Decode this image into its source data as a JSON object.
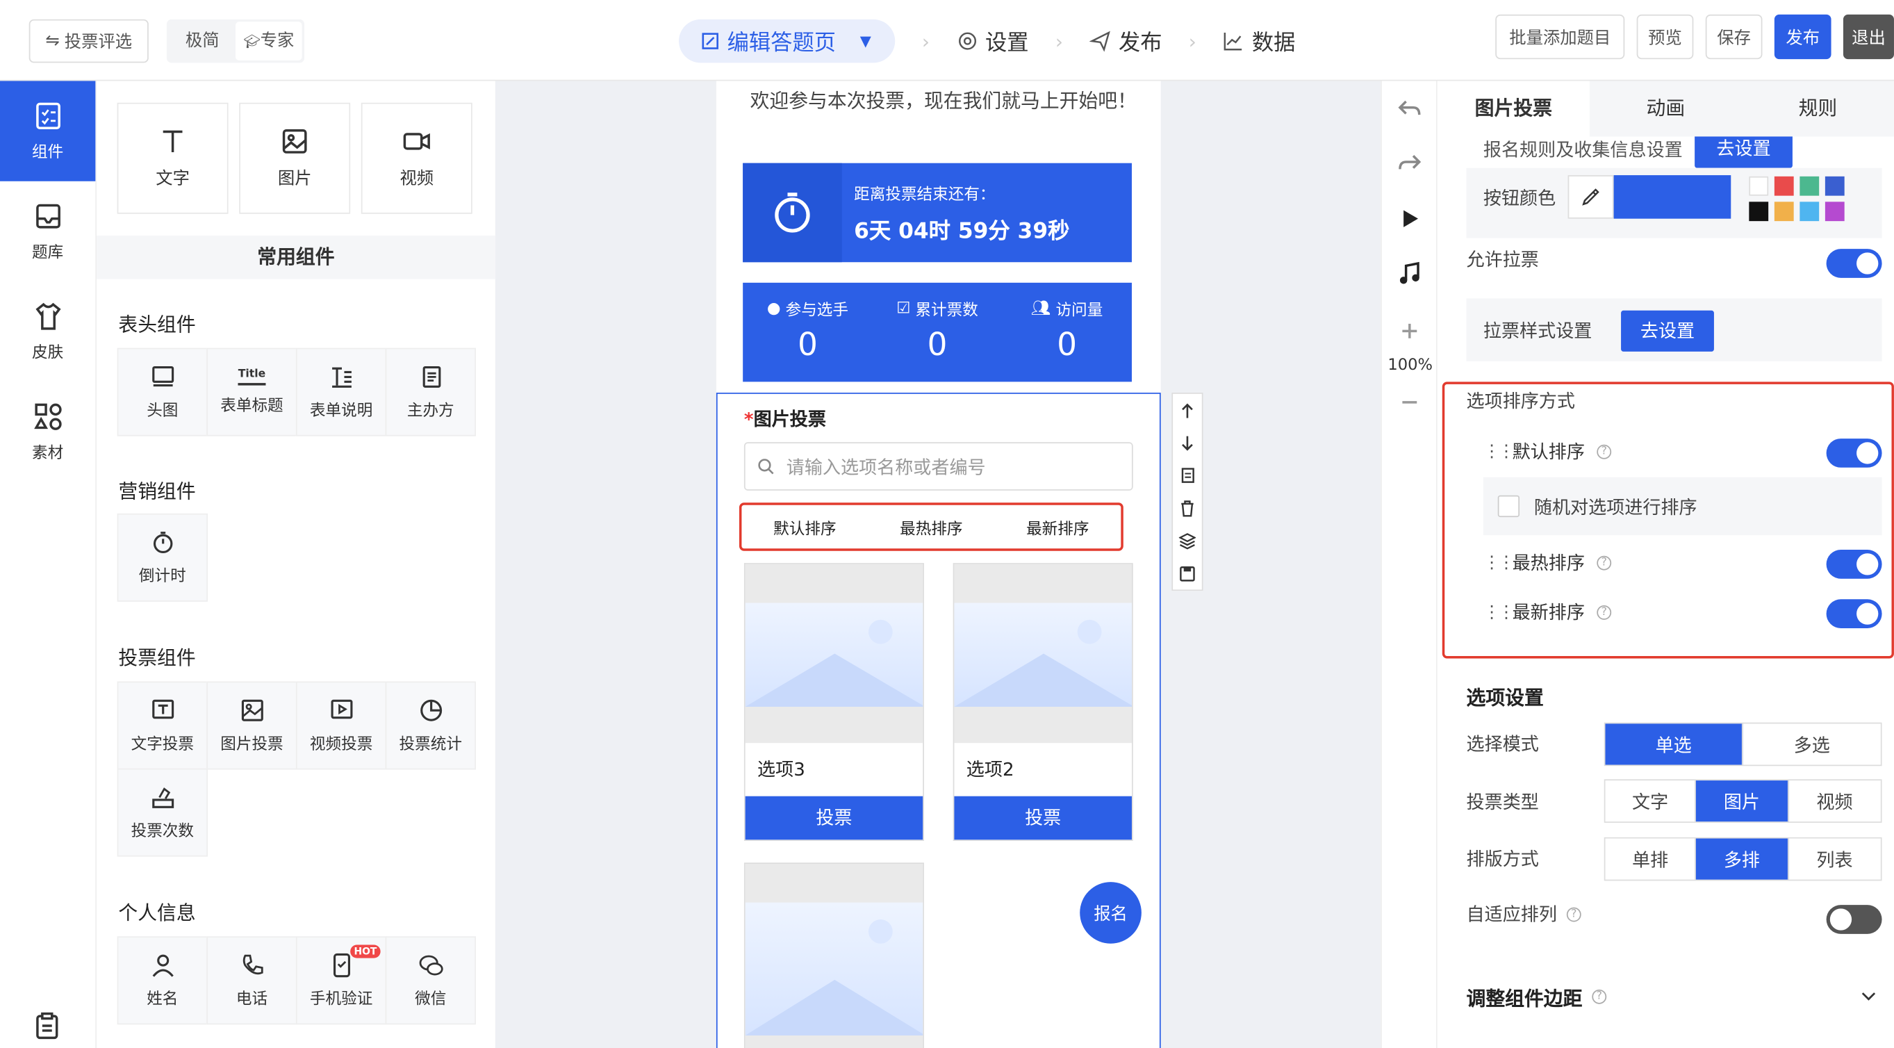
{
  "header": {
    "back_label": "投票评选",
    "mode_simple": "极简",
    "mode_expert": "专家",
    "steps": [
      "编辑答题页",
      "设置",
      "发布",
      "数据"
    ],
    "buttons": {
      "batch_add": "批量添加题目",
      "preview": "预览",
      "save": "保存",
      "publish": "发布",
      "exit": "退出"
    }
  },
  "rail": {
    "items": [
      "组件",
      "题库",
      "皮肤",
      "素材"
    ]
  },
  "components": {
    "basic": [
      "文字",
      "图片",
      "视频"
    ],
    "common_header": "常用组件",
    "sections": [
      {
        "title": "表头组件",
        "items": [
          "头图",
          "表单标题",
          "表单说明",
          "主办方"
        ]
      },
      {
        "title": "营销组件",
        "items": [
          "倒计时"
        ]
      },
      {
        "title": "投票组件",
        "items": [
          "文字投票",
          "图片投票",
          "视频投票",
          "投票统计",
          "投票次数"
        ]
      },
      {
        "title": "个人信息",
        "items": [
          "姓名",
          "电话",
          "手机验证",
          "微信"
        ]
      }
    ],
    "hot_badge": "HOT",
    "title_glyph": "Title"
  },
  "preview": {
    "welcome": "欢迎参与本次投票，现在我们就马上开始吧！",
    "timer_label": "距离投票结束还有：",
    "timer_value": "6天 04时 59分 39秒",
    "stats": [
      {
        "label": "参与选手",
        "value": "0"
      },
      {
        "label": "累计票数",
        "value": "0"
      },
      {
        "label": "访问量",
        "value": "0"
      }
    ],
    "question_star": "*",
    "question_title": "图片投票",
    "search_placeholder": "请输入选项名称或者编号",
    "sort_tabs": [
      "默认排序",
      "最热排序",
      "最新排序"
    ],
    "cards": [
      {
        "name": "选项3",
        "button": "投票"
      },
      {
        "name": "选项2",
        "button": "投票"
      }
    ],
    "signup": "报名"
  },
  "sidetools": {
    "zoom": "100%"
  },
  "props": {
    "tabs": [
      "图片投票",
      "动画",
      "规则"
    ],
    "signup_rule_label": "报名规则及收集信息设置",
    "go_setting": "去设置",
    "button_color_label": "按钮颜色",
    "button_color": "#2c5fe6",
    "palette": [
      "#ffffff",
      "#e94b4b",
      "#4cb88f",
      "#3a5fd0",
      "#111111",
      "#f1b04a",
      "#4fb5f0",
      "#b54ad0"
    ],
    "allow_canvass": "允许拉票",
    "canvass_style": "拉票样式设置",
    "sort_section": "选项排序方式",
    "sort_rows": [
      {
        "label": "默认排序",
        "on": true
      },
      {
        "label": "最热排序",
        "on": true
      },
      {
        "label": "最新排序",
        "on": true
      }
    ],
    "random_sort": "随机对选项进行排序",
    "option_settings": "选项设置",
    "select_mode_label": "选择模式",
    "select_modes": [
      "单选",
      "多选"
    ],
    "vote_type_label": "投票类型",
    "vote_types": [
      "文字",
      "图片",
      "视频"
    ],
    "layout_label": "排版方式",
    "layouts": [
      "单排",
      "多排",
      "列表"
    ],
    "adaptive_label": "自适应排列",
    "margin_label": "调整组件边距",
    "help_glyph": "?"
  }
}
